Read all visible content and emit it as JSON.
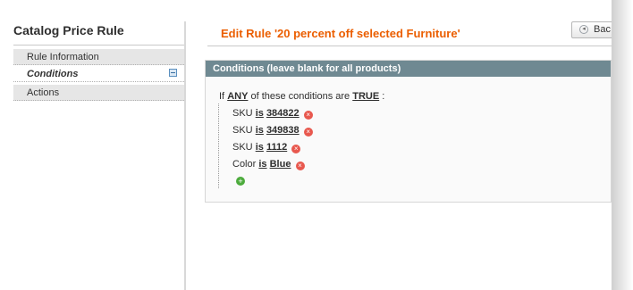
{
  "sidebar": {
    "title": "Catalog Price Rule",
    "items": [
      {
        "label": "Rule Information"
      },
      {
        "label": "Conditions"
      },
      {
        "label": "Actions"
      }
    ]
  },
  "header": {
    "title": "Edit Rule '20 percent off selected Furniture'",
    "back_label": "Bac"
  },
  "conditions": {
    "header": "Conditions (leave blank for all products)",
    "if_text": "If",
    "aggregator": "ANY",
    "middle_text": "of these conditions are",
    "value": "TRUE",
    "suffix": ":",
    "rows": [
      {
        "attribute": "SKU",
        "operator": "is",
        "value": "384822"
      },
      {
        "attribute": "SKU",
        "operator": "is",
        "value": "349838"
      },
      {
        "attribute": "SKU",
        "operator": "is",
        "value": "1112"
      },
      {
        "attribute": "Color",
        "operator": "is",
        "value": "Blue"
      }
    ],
    "remove_glyph": "×",
    "add_glyph": "+"
  },
  "colors": {
    "accent": "#eb5e00",
    "header_bg": "#6f8992",
    "remove": "#e8584e",
    "add": "#4cab3c"
  }
}
